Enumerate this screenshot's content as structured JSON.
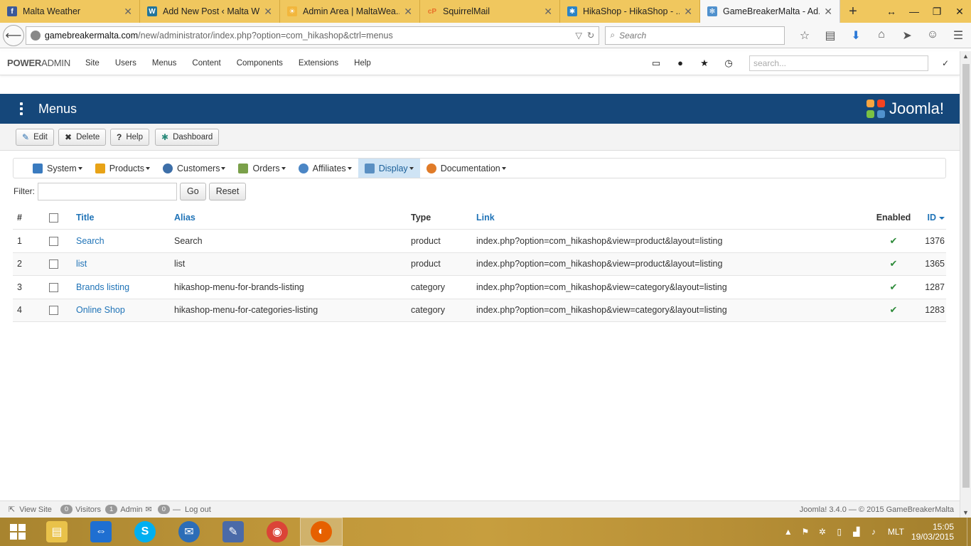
{
  "browser": {
    "tabs": [
      {
        "title": "Malta Weather",
        "favicon": "facebook-icon",
        "color": "#3b5998"
      },
      {
        "title": "Add New Post ‹ Malta Weat...",
        "favicon": "wordpress-icon",
        "color": "#21759b"
      },
      {
        "title": "Admin Area | MaltaWea...",
        "favicon": "weather-icon",
        "color": "#f2b63c"
      },
      {
        "title": "SquirrelMail",
        "favicon": "cpanel-icon",
        "color": "#e8702a"
      },
      {
        "title": "HikaShop - HikaShop - ...",
        "favicon": "hikashop-icon",
        "color": "#2a83c6"
      },
      {
        "title": "GameBreakerMalta - Ad...",
        "favicon": "joomla-icon",
        "color": "#5091cd"
      }
    ],
    "url_host": "gamebreakermalta.com",
    "url_path": "/new/administrator/index.php?option=com_hikashop&ctrl=menus",
    "search_placeholder": "Search"
  },
  "adminbar": {
    "brand_bold": "POWER",
    "brand_rest": "ADMIN",
    "menu": [
      "Site",
      "Users",
      "Menus",
      "Content",
      "Components",
      "Extensions",
      "Help"
    ],
    "search_placeholder": "search..."
  },
  "header": {
    "title": "Menus",
    "logo_text": "Joomla!"
  },
  "toolbar": {
    "edit": "Edit",
    "delete": "Delete",
    "help": "Help",
    "dashboard": "Dashboard"
  },
  "hikamenu": {
    "items": [
      {
        "label": "System",
        "icon": "tools-icon",
        "color": "#3a7bbf"
      },
      {
        "label": "Products",
        "icon": "box-icon",
        "color": "#e8a317"
      },
      {
        "label": "Customers",
        "icon": "users-icon",
        "color": "#3d6fa8"
      },
      {
        "label": "Orders",
        "icon": "orders-icon",
        "color": "#7aa04a"
      },
      {
        "label": "Affiliates",
        "icon": "affiliates-icon",
        "color": "#4b86c5"
      },
      {
        "label": "Display",
        "icon": "display-icon",
        "color": "#5a8fc2",
        "active": true
      },
      {
        "label": "Documentation",
        "icon": "documentation-icon",
        "color": "#e07b28"
      }
    ]
  },
  "filter": {
    "label": "Filter:",
    "value": "",
    "go": "Go",
    "reset": "Reset"
  },
  "table": {
    "headers": {
      "num": "#",
      "title": "Title",
      "alias": "Alias",
      "type": "Type",
      "link": "Link",
      "enabled": "Enabled",
      "id": "ID"
    },
    "rows": [
      {
        "num": "1",
        "title": "Search",
        "alias": "Search",
        "type": "product",
        "link": "index.php?option=com_hikashop&view=product&layout=listing",
        "enabled": "✔",
        "id": "1376"
      },
      {
        "num": "2",
        "title": "list",
        "alias": "list",
        "type": "product",
        "link": "index.php?option=com_hikashop&view=product&layout=listing",
        "enabled": "✔",
        "id": "1365"
      },
      {
        "num": "3",
        "title": "Brands listing",
        "alias": "hikashop-menu-for-brands-listing",
        "type": "category",
        "link": "index.php?option=com_hikashop&view=category&layout=listing",
        "enabled": "✔",
        "id": "1287"
      },
      {
        "num": "4",
        "title": "Online Shop",
        "alias": "hikashop-menu-for-categories-listing",
        "type": "category",
        "link": "index.php?option=com_hikashop&view=category&layout=listing",
        "enabled": "✔",
        "id": "1283"
      }
    ]
  },
  "statusbar": {
    "view_site": "View Site",
    "visitors_count": "0",
    "visitors": "Visitors",
    "admin_count": "1",
    "admin": "Admin",
    "messages_count": "0",
    "logout": "Log out",
    "version": "Joomla! 3.4.0 — © 2015 GameBreakerMalta"
  },
  "taskbar": {
    "apps": [
      {
        "name": "file-explorer-icon",
        "color": "#e9c24a",
        "glyph": "▤"
      },
      {
        "name": "teamviewer-icon",
        "color": "#1f6fd1",
        "glyph": "⇔"
      },
      {
        "name": "skype-icon",
        "color": "#00aff0",
        "glyph": "S"
      },
      {
        "name": "thunderbird-icon",
        "color": "#2c6db7",
        "glyph": "✉"
      },
      {
        "name": "paint-icon",
        "color": "#4a6aa8",
        "glyph": "✎"
      },
      {
        "name": "chrome-icon",
        "color": "#db4437",
        "glyph": "◉"
      },
      {
        "name": "firefox-icon",
        "color": "#e66000",
        "glyph": "◐",
        "active": true
      }
    ],
    "lang": "MLT",
    "time": "15:05",
    "date": "19/03/2015"
  }
}
